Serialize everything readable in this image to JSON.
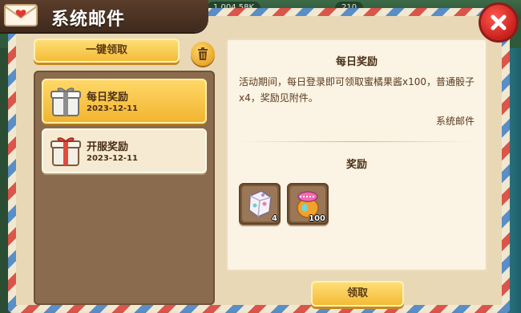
{
  "background": {
    "currency_value": "1,004.58K",
    "gem_value": "210"
  },
  "window": {
    "title": "系统邮件"
  },
  "left": {
    "collect_all_label": "一键领取",
    "mails": [
      {
        "title": "每日奖励",
        "date": "2023-12-11",
        "selected": true
      },
      {
        "title": "开服奖励",
        "date": "2023-12-11",
        "selected": false
      }
    ]
  },
  "detail": {
    "title": "每日奖励",
    "body": "活动期间，每日登录即可领取蜜橘果酱x100，普通骰子x4，奖励见附件。",
    "sender": "系统邮件",
    "reward_title": "奖励",
    "rewards": [
      {
        "icon": "dice-icon",
        "count": "4"
      },
      {
        "icon": "jam-jar-icon",
        "count": "100"
      }
    ],
    "claim_label": "领取"
  },
  "colors": {
    "title_bar": "#4f3524",
    "button_yellow": "#f3b933",
    "close_red": "#d6302a",
    "paper": "#fbf3e3"
  }
}
